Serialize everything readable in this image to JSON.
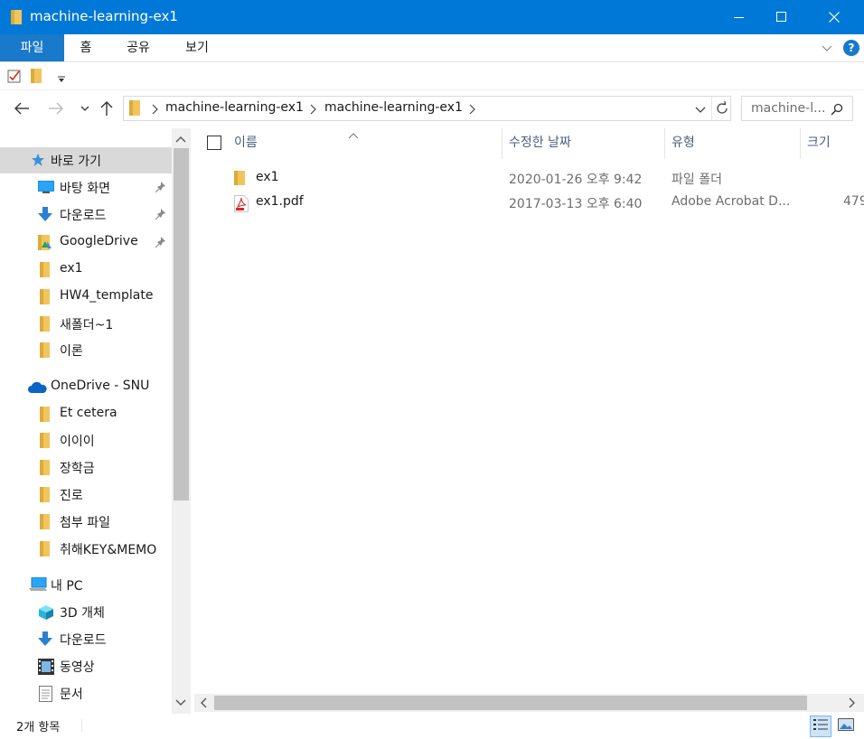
{
  "window": {
    "title": "machine-learning-ex1",
    "minimize_glyph": "—",
    "maximize_glyph": "☐",
    "close_glyph": "✕",
    "accent": "#0078d7"
  },
  "ribbon": {
    "tabs": [
      {
        "label": "파일",
        "active": true
      },
      {
        "label": "홈",
        "active": false
      },
      {
        "label": "공유",
        "active": false
      },
      {
        "label": "보기",
        "active": false
      }
    ],
    "help_glyph": "?"
  },
  "qat": {
    "icons": [
      "properties-checkbox-icon",
      "new-folder-icon",
      "customize-dropdown-icon"
    ]
  },
  "addressbar": {
    "breadcrumbs": [
      "machine-learning-ex1",
      "machine-learning-ex1"
    ],
    "search_placeholder": "machine-l..."
  },
  "nav": {
    "items": [
      {
        "label": "바로 가기",
        "icon": "star-icon",
        "level": 0,
        "selected": true,
        "pinned": false
      },
      {
        "label": "바탕 화면",
        "icon": "desktop-icon",
        "level": 1,
        "selected": false,
        "pinned": true
      },
      {
        "label": "다운로드",
        "icon": "download-icon",
        "level": 1,
        "selected": false,
        "pinned": true
      },
      {
        "label": "GoogleDrive",
        "icon": "google-drive-folder-icon",
        "level": 1,
        "selected": false,
        "pinned": true
      },
      {
        "label": "ex1",
        "icon": "folder-icon",
        "level": 1,
        "selected": false,
        "pinned": false
      },
      {
        "label": "HW4_template",
        "icon": "folder-icon",
        "level": 1,
        "selected": false,
        "pinned": false
      },
      {
        "label": "새폴더~1",
        "icon": "folder-icon",
        "level": 1,
        "selected": false,
        "pinned": false
      },
      {
        "label": "이론",
        "icon": "folder-icon",
        "level": 1,
        "selected": false,
        "pinned": false
      },
      {
        "label": "OneDrive - SNU",
        "icon": "onedrive-cloud-icon",
        "level": 0,
        "selected": false,
        "pinned": false
      },
      {
        "label": "Et cetera",
        "icon": "folder-icon",
        "level": 1,
        "selected": false,
        "pinned": false
      },
      {
        "label": "이이이",
        "icon": "folder-icon",
        "level": 1,
        "selected": false,
        "pinned": false
      },
      {
        "label": "장학금",
        "icon": "folder-icon",
        "level": 1,
        "selected": false,
        "pinned": false
      },
      {
        "label": "진로",
        "icon": "folder-icon",
        "level": 1,
        "selected": false,
        "pinned": false
      },
      {
        "label": "첨부 파일",
        "icon": "folder-icon",
        "level": 1,
        "selected": false,
        "pinned": false
      },
      {
        "label": "취해KEY&MEMO",
        "icon": "folder-icon",
        "level": 1,
        "selected": false,
        "pinned": false
      },
      {
        "label": "내 PC",
        "icon": "pc-icon",
        "level": 0,
        "selected": false,
        "pinned": false
      },
      {
        "label": "3D 개체",
        "icon": "3d-objects-icon",
        "level": 1,
        "selected": false,
        "pinned": false
      },
      {
        "label": "다운로드",
        "icon": "download-icon",
        "level": 1,
        "selected": false,
        "pinned": false
      },
      {
        "label": "동영상",
        "icon": "video-icon",
        "level": 1,
        "selected": false,
        "pinned": false
      },
      {
        "label": "문서",
        "icon": "document-icon",
        "level": 1,
        "selected": false,
        "pinned": false
      }
    ]
  },
  "content": {
    "columns": [
      "이름",
      "수정한 날짜",
      "유형",
      "크기"
    ],
    "files": [
      {
        "name": "ex1",
        "icon": "folder-icon",
        "modified": "2020-01-26 오후 9:42",
        "type": "파일 폴더",
        "size": ""
      },
      {
        "name": "ex1.pdf",
        "icon": "pdf-file-icon",
        "modified": "2017-03-13 오후 6:40",
        "type": "Adobe Acrobat D...",
        "size": "479"
      }
    ]
  },
  "status": {
    "item_count": "2개 항목"
  }
}
